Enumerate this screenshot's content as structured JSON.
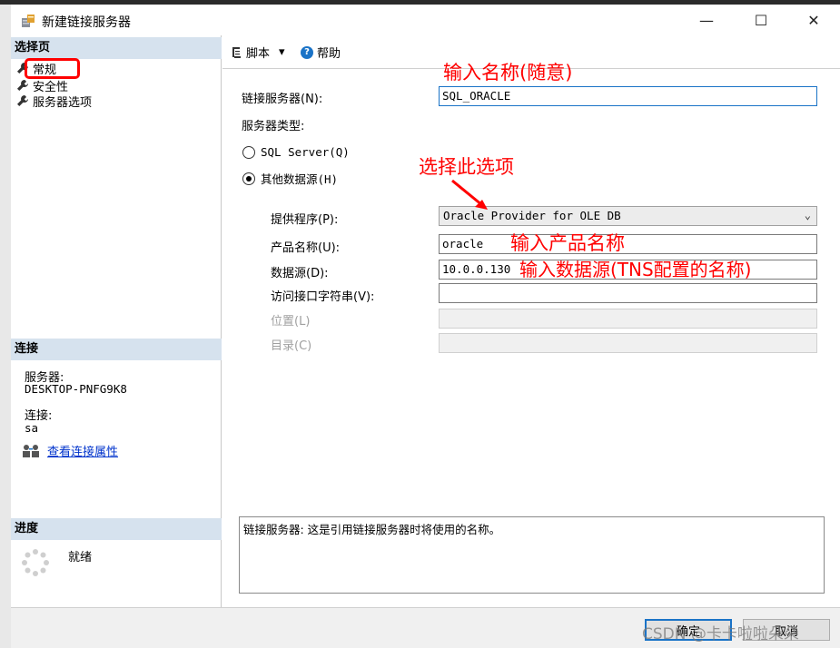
{
  "window": {
    "title": "新建链接服务器"
  },
  "window_controls": {
    "minimize": "—",
    "maximize": "☐",
    "close": "✕"
  },
  "left_pane": {
    "pages_header": "选择页",
    "pages": [
      {
        "label": "常规",
        "icon": "wrench-icon"
      },
      {
        "label": "安全性",
        "icon": "wrench-icon"
      },
      {
        "label": "服务器选项",
        "icon": "wrench-icon"
      }
    ],
    "connection_header": "连接",
    "server_label": "服务器:",
    "server_value": "DESKTOP-PNFG9K8",
    "connection_label": "连接:",
    "connection_value": "sa",
    "view_props_link": "查看连接属性",
    "progress_header": "进度",
    "progress_status": "就绪"
  },
  "toolbar": {
    "script_label": "脚本",
    "script_dropdown": "▾",
    "help_label": "帮助"
  },
  "form": {
    "linked_server_label": "链接服务器(N):",
    "linked_server_value": "SQL_ORACLE",
    "server_type_label": "服务器类型:",
    "radio_sql_server": "SQL Server(Q)",
    "radio_other": "其他数据源(H)",
    "selected_server_type": "其他数据源(H)",
    "provider_label": "提供程序(P):",
    "provider_value": "Oracle Provider for OLE DB",
    "product_name_label": "产品名称(U):",
    "product_name_value": "oracle",
    "data_source_label": "数据源(D):",
    "data_source_value": "10.0.0.130",
    "provider_string_label": "访问接口字符串(V):",
    "provider_string_value": "",
    "location_label": "位置(L)",
    "catalog_label": "目录(C)",
    "description": "链接服务器: 这是引用链接服务器时将使用的名称。"
  },
  "annotations": {
    "name_hint": "输入名称(随意)",
    "select_hint": "选择此选项",
    "product_hint": "输入产品名称",
    "data_source_hint": "输入数据源(TNS配置的名称)"
  },
  "buttons": {
    "ok": "确定",
    "cancel": "取消"
  },
  "watermark": "CSDN @卡卡啦啦朵朵",
  "colors": {
    "annotation": "#ff0000",
    "section_header": "#d6e2ee",
    "link": "#0033cc",
    "accent": "#1a73c7"
  }
}
